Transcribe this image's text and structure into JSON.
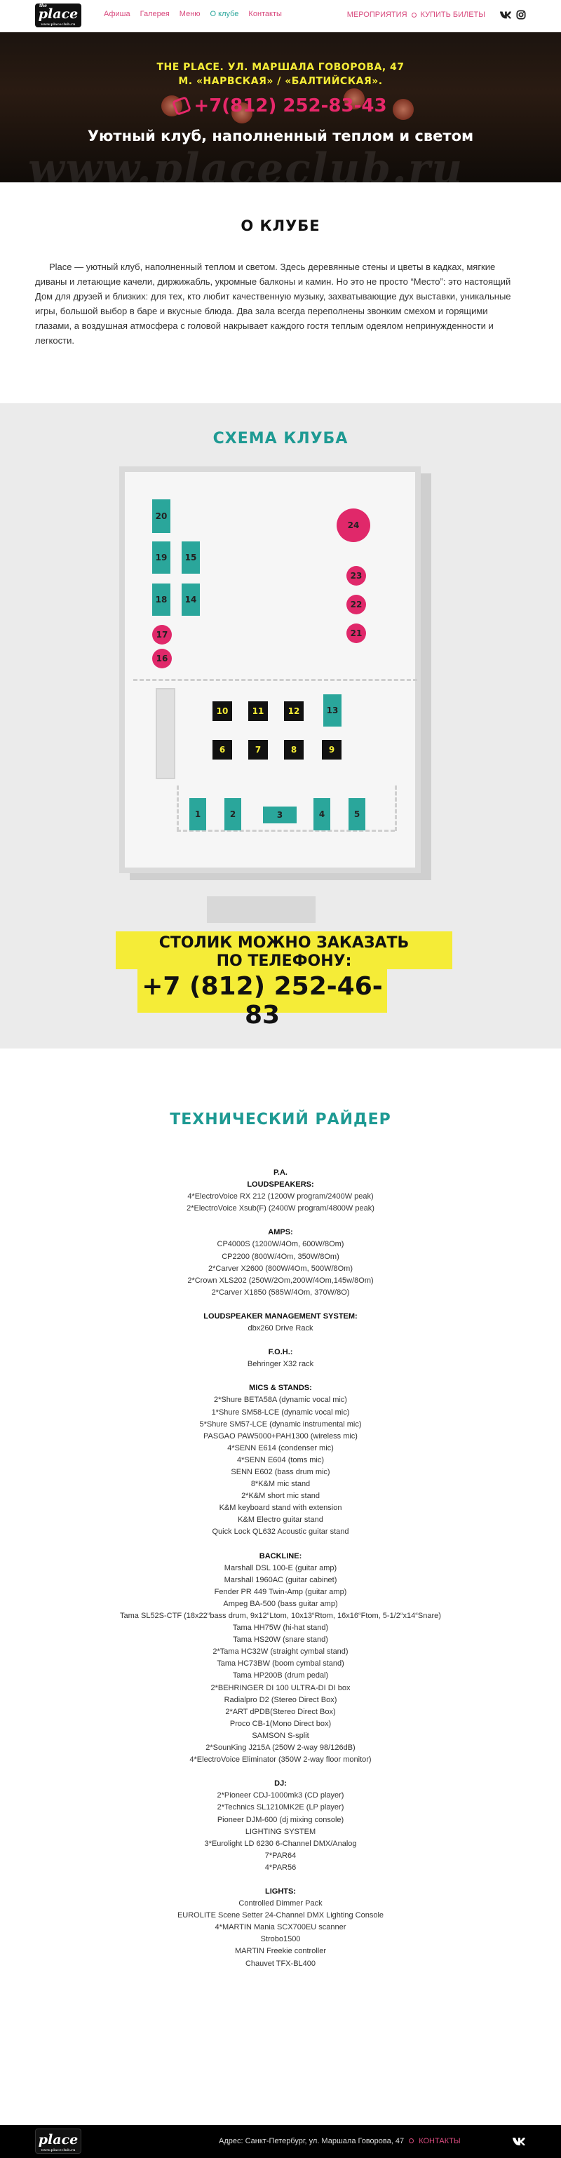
{
  "nav": {
    "logo_text": "place",
    "logo_the": "the",
    "logo_url": "www.placeclub.ru",
    "links": [
      {
        "label": "Афиша",
        "active": false
      },
      {
        "label": "Галерея",
        "active": false
      },
      {
        "label": "Меню",
        "active": false
      },
      {
        "label": "О клубе",
        "active": true
      },
      {
        "label": "Контакты",
        "active": false
      }
    ],
    "events_label": "МЕРОПРИЯТИЯ",
    "tickets_label": "КУПИТЬ БИЛЕТЫ",
    "social_icons": [
      "vk-icon",
      "instagram-icon"
    ]
  },
  "hero": {
    "address_line1": "THE PLACE. УЛ. МАРШАЛА ГОВОРОВА, 47",
    "address_line2": "М. «НАРВСКАЯ» / «БАЛТИЙСКАЯ».",
    "phone": "+7(812) 252-83-43",
    "tagline": "Уютный клуб, наполненный теплом и светом",
    "watermark": "www.placeclub.ru"
  },
  "about": {
    "title": "О КЛУБЕ",
    "text": "Place — уютный клуб, наполненный теплом и светом. Здесь деревянные стены и цветы в кадках, мягкие диваны и летающие качели, диржижабль, укромные балконы и камин. Но это не просто “Место”: это настоящий Дом для друзей и близких: для тех, кто любит качественную музыку, захватывающие дух выставки, уникальные игры, большой выбор в баре и вкусные блюда. Два зала всегда переполнены звонким смехом и горящими глазами, а воздушная атмосфера с головой накрывает каждого гостя теплым одеялом непринужденности и легкости."
  },
  "scheme": {
    "title": "СХЕМА КЛУБА",
    "colors": {
      "teal": "#2aa69b",
      "black": "#111111",
      "pink": "#e0286a",
      "yellow": "#f5ec37"
    },
    "tables": [
      {
        "n": "20",
        "kind": "teal"
      },
      {
        "n": "19",
        "kind": "teal"
      },
      {
        "n": "15",
        "kind": "teal"
      },
      {
        "n": "18",
        "kind": "teal"
      },
      {
        "n": "14",
        "kind": "teal"
      },
      {
        "n": "17",
        "kind": "pink"
      },
      {
        "n": "16",
        "kind": "pink"
      },
      {
        "n": "24",
        "kind": "pink"
      },
      {
        "n": "23",
        "kind": "pink"
      },
      {
        "n": "22",
        "kind": "pink"
      },
      {
        "n": "21",
        "kind": "pink"
      },
      {
        "n": "10",
        "kind": "black"
      },
      {
        "n": "11",
        "kind": "black"
      },
      {
        "n": "12",
        "kind": "black"
      },
      {
        "n": "13",
        "kind": "teal"
      },
      {
        "n": "6",
        "kind": "black"
      },
      {
        "n": "7",
        "kind": "black"
      },
      {
        "n": "8",
        "kind": "black"
      },
      {
        "n": "9",
        "kind": "black"
      },
      {
        "n": "1",
        "kind": "teal"
      },
      {
        "n": "2",
        "kind": "teal"
      },
      {
        "n": "3",
        "kind": "teal"
      },
      {
        "n": "4",
        "kind": "teal"
      },
      {
        "n": "5",
        "kind": "teal"
      }
    ]
  },
  "booking": {
    "line1": "СТОЛИК МОЖНО ЗАКАЗАТЬ",
    "line2": "ПО ТЕЛЕФОНУ:",
    "phone": "+7 (812) 252-46-83"
  },
  "rider": {
    "title": "ТЕХНИЧЕСКИЙ РАЙДЕР",
    "lines": [
      {
        "t": "P.A.",
        "h": true
      },
      {
        "t": "LOUDSPEAKERS:",
        "h": true
      },
      {
        "t": "4*ElectroVoice RX 212 (1200W program/2400W peak)"
      },
      {
        "t": "2*ElectroVoice Xsub(F) (2400W program/4800W peak)"
      },
      {
        "t": "",
        "gap": true
      },
      {
        "t": "AMPS:",
        "h": true
      },
      {
        "t": "CP4000S (1200W/4Om, 600W/8Om)"
      },
      {
        "t": "CP2200 (800W/4Om, 350W/8Om)"
      },
      {
        "t": "2*Carver X2600 (800W/4Om, 500W/8Om)"
      },
      {
        "t": "2*Crown XLS202 (250W/2Om,200W/4Om,145w/8Om)"
      },
      {
        "t": "2*Carver X1850 (585W/4Om, 370W/8O)"
      },
      {
        "t": "",
        "gap": true
      },
      {
        "t": "LOUDSPEAKER MANAGEMENT SYSTEM:",
        "h": true
      },
      {
        "t": "dbx260 Drive Rack"
      },
      {
        "t": "",
        "gap": true
      },
      {
        "t": "F.O.H.:",
        "h": true
      },
      {
        "t": "Behringer X32 rack"
      },
      {
        "t": "",
        "gap": true
      },
      {
        "t": "MICS & STANDS:",
        "h": true
      },
      {
        "t": "2*Shure BETA58A (dynamic vocal mic)"
      },
      {
        "t": "1*Shure SM58-LCE (dynamic vocal mic)"
      },
      {
        "t": "5*Shure SM57-LCE (dynamic instrumental mic)"
      },
      {
        "t": "PASGAO PAW5000+PAH1300 (wireless mic)"
      },
      {
        "t": "4*SENN E614 (condenser mic)"
      },
      {
        "t": "4*SENN E604 (toms mic)"
      },
      {
        "t": "SENN E602 (bass drum mic)"
      },
      {
        "t": "8*K&M mic stand"
      },
      {
        "t": "2*K&M short mic stand"
      },
      {
        "t": "K&M keyboard stand with extension"
      },
      {
        "t": "K&M Electro guitar stand"
      },
      {
        "t": "Quick Lock QL632 Acoustic guitar stand"
      },
      {
        "t": "",
        "gap": true
      },
      {
        "t": "BACKLINE:",
        "h": true
      },
      {
        "t": "Marshall DSL 100-E (guitar amp)"
      },
      {
        "t": "Marshall 1960AC (guitar cabinet)"
      },
      {
        "t": "Fender PR 449 Twin-Amp (guitar amp)"
      },
      {
        "t": "Ampeg BA-500 (bass guitar amp)"
      },
      {
        "t": "Tama SL52S-CTF (18x22“bass drum, 9x12“Ltom, 10x13“Rtom, 16x16“Ftom, 5-1/2“x14“Snare)"
      },
      {
        "t": "Tama HH75W (hi-hat stand)"
      },
      {
        "t": "Tama HS20W (snare stand)"
      },
      {
        "t": "2*Tama HC32W (straight cymbal stand)"
      },
      {
        "t": "Tama HC73BW (boom cymbal stand)"
      },
      {
        "t": "Tama HP200B (drum pedal)"
      },
      {
        "t": "2*BEHRINGER DI 100 ULTRA-DI DI box"
      },
      {
        "t": "Radialpro D2 (Stereo Direct Box)"
      },
      {
        "t": "2*ART dPDB(Stereo Direct Box)"
      },
      {
        "t": "Proco CB-1(Mono Direct box)"
      },
      {
        "t": "SAMSON S-split"
      },
      {
        "t": "2*SounKing J215A (250W 2-way 98/126dB)"
      },
      {
        "t": "4*ElectroVoice Eliminator (350W 2-way floor monitor)"
      },
      {
        "t": "",
        "gap": true
      },
      {
        "t": "DJ:",
        "h": true
      },
      {
        "t": "2*Pioneer CDJ-1000mk3 (CD player)"
      },
      {
        "t": "2*Technics SL1210MK2E (LP player)"
      },
      {
        "t": "Pioneer DJM-600 (dj mixing console)"
      },
      {
        "t": "LIGHTING SYSTEM"
      },
      {
        "t": "3*Eurolight LD 6230 6-Channel DMX/Analog"
      },
      {
        "t": "7*PAR64"
      },
      {
        "t": "4*PAR56"
      },
      {
        "t": "",
        "gap": true
      },
      {
        "t": "LIGHTS:",
        "h": true
      },
      {
        "t": "Controlled Dimmer Pack"
      },
      {
        "t": "EUROLITE Scene Setter 24-Channel DMX Lighting Console"
      },
      {
        "t": "4*MARTIN Mania SCX700EU scanner"
      },
      {
        "t": "Strobo1500"
      },
      {
        "t": "MARTIN Freekie controller"
      },
      {
        "t": "Chauvet TFX-BL400"
      }
    ]
  },
  "footer": {
    "address": "Адрес: Санкт-Петербург, ул. Маршала Говорова, 47",
    "contacts_label": "КОНТАКТЫ",
    "logo_text": "place",
    "logo_url": "www.placeclub.ru"
  }
}
